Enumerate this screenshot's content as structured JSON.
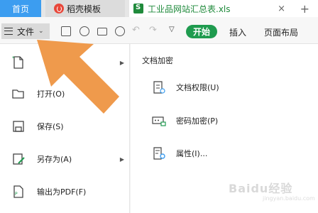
{
  "tabs": {
    "home": "首页",
    "template": "稻壳模板",
    "file": "工业品网站汇总表.xls",
    "close_glyph": "×",
    "add_glyph": "+"
  },
  "toolbar": {
    "file_label": "文件",
    "start_label": "开始",
    "insert_label": "插入",
    "page_layout_label": "页面布局",
    "icons": [
      "save-icon",
      "format-painter-icon",
      "print-icon",
      "print-preview-icon",
      "undo-icon",
      "redo-icon",
      "more-icon"
    ]
  },
  "file_menu": {
    "items": [
      {
        "label": "",
        "icon": "new-file-icon",
        "has_submenu": true
      },
      {
        "label": "打开(O)",
        "icon": "open-folder-icon",
        "has_submenu": false
      },
      {
        "label": "保存(S)",
        "icon": "save-icon",
        "has_submenu": false
      },
      {
        "label": "另存为(A)",
        "icon": "save-as-icon",
        "has_submenu": true
      },
      {
        "label": "输出为PDF(F)",
        "icon": "export-pdf-icon",
        "has_submenu": false
      }
    ]
  },
  "submenu": {
    "title": "文档加密",
    "items": [
      {
        "label": "文档权限(U)",
        "icon": "document-permission-icon"
      },
      {
        "label": "密码加密(P)",
        "icon": "password-encrypt-icon"
      },
      {
        "label": "属性(I)...",
        "icon": "properties-icon"
      }
    ]
  },
  "watermark": {
    "text": "Baidu经验",
    "sub": "jingyan.baidu.com"
  },
  "colors": {
    "accent_blue": "#3c9df0",
    "start_green": "#1f9b4f",
    "file_green": "#1f8a3b",
    "overlay_arrow": "#ef9a4c"
  }
}
